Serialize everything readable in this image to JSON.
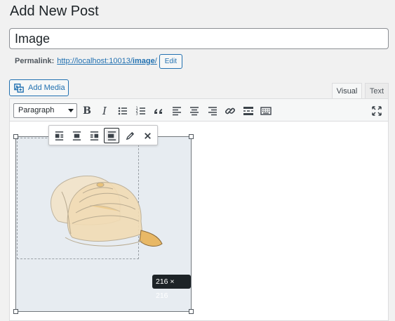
{
  "page": {
    "title": "Add New Post"
  },
  "post": {
    "title_value": "Image",
    "permalink_label": "Permalink:",
    "permalink_base": "http://localhost:10013/",
    "permalink_slug": "image",
    "permalink_trailing": "/",
    "edit_label": "Edit"
  },
  "media": {
    "add_media_label": "Add Media"
  },
  "editor_tabs": {
    "visual": "Visual",
    "text": "Text",
    "active": "visual"
  },
  "toolbar": {
    "format_value": "Paragraph",
    "buttons": [
      "bold-icon",
      "italic-icon",
      "bulleted-list-icon",
      "numbered-list-icon",
      "blockquote-icon",
      "align-left-icon",
      "align-center-icon",
      "align-right-icon",
      "link-icon",
      "read-more-icon",
      "toolbar-toggle-icon",
      "fullscreen-icon"
    ]
  },
  "image_toolbar": {
    "buttons": [
      "align-left-icon",
      "align-center-icon",
      "align-right-icon",
      "align-none-icon",
      "edit-icon",
      "remove-icon"
    ],
    "active": "align-none-icon"
  },
  "image": {
    "size_label": "216 × 216",
    "subject": "baseball-cap"
  },
  "colors": {
    "accent": "#2271b1",
    "badge_bg": "#1d2327",
    "image_bg": "#e7ecf1"
  }
}
